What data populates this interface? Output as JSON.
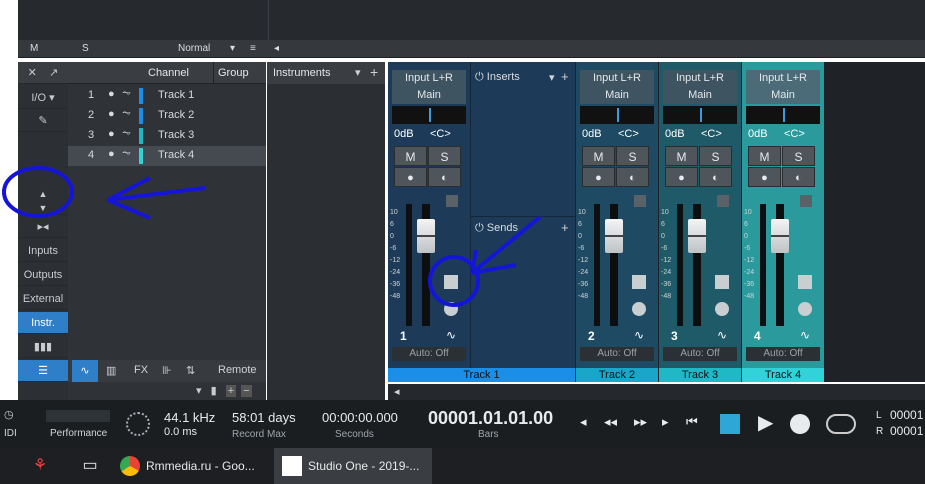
{
  "topbar": {
    "m_label": "M",
    "s_label": "S",
    "mode": "Normal"
  },
  "left_buttons": {
    "io": "I/O",
    "inputs": "Inputs",
    "outputs": "Outputs",
    "external": "External",
    "instr": "Instr."
  },
  "channel_list": {
    "header_channel": "Channel",
    "header_group": "Group",
    "tracks": [
      {
        "num": "1",
        "name": "Track 1",
        "color": "#1b8fe8"
      },
      {
        "num": "2",
        "name": "Track 2",
        "color": "#1b8fe8"
      },
      {
        "num": "3",
        "name": "Track 3",
        "color": "#1fb9c6"
      },
      {
        "num": "4",
        "name": "Track 4",
        "color": "#31d3d8"
      }
    ],
    "bottom_remote": "Remote",
    "bottom_fx": "FX"
  },
  "instruments": {
    "header": "Instruments"
  },
  "inserts_label": "Inserts",
  "sends_label": "Sends",
  "strips": [
    {
      "input": "Input L+R",
      "output": "Main",
      "vol": "0dB",
      "pan": "<C>",
      "m": "M",
      "s": "S",
      "num": "1",
      "auto": "Auto: Off",
      "label": "Track 1",
      "color": "#1b8fe8"
    },
    {
      "input": "Input L+R",
      "output": "Main",
      "vol": "0dB",
      "pan": "<C>",
      "m": "M",
      "s": "S",
      "num": "2",
      "auto": "Auto: Off",
      "label": "Track 2",
      "color": "#1aa6c9"
    },
    {
      "input": "Input L+R",
      "output": "Main",
      "vol": "0dB",
      "pan": "<C>",
      "m": "M",
      "s": "S",
      "num": "3",
      "auto": "Auto: Off",
      "label": "Track 3",
      "color": "#1fb9c6"
    },
    {
      "input": "Input L+R",
      "output": "Main",
      "vol": "0dB",
      "pan": "<C>",
      "m": "M",
      "s": "S",
      "num": "4",
      "auto": "Auto: Off",
      "label": "Track 4",
      "color": "#31d3d8"
    }
  ],
  "scale_marks": [
    "10",
    "6",
    "0",
    "-6",
    "-12",
    "-24",
    "-36",
    "-48"
  ],
  "transport": {
    "idi": "IDI",
    "performance": "Performance",
    "khz": "44.1 kHz",
    "ms": "0.0 ms",
    "days": "58:01 days",
    "record_max": "Record Max",
    "seconds_val": "00:00:00.000",
    "seconds": "Seconds",
    "bars_val": "00001.01.01.00",
    "bars": "Bars",
    "l": "L",
    "r": "R",
    "l_val": "00001",
    "r_val": "00001"
  },
  "taskbar": {
    "chrome": "Rmmedia.ru - Goo...",
    "studio": "Studio One - 2019-..."
  }
}
